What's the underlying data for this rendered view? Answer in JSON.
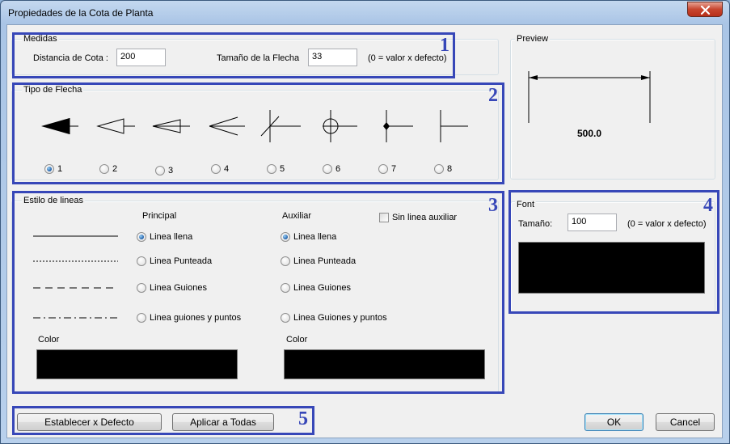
{
  "window": {
    "title": "Propiedades de la Cota de Planta"
  },
  "medidas": {
    "group_label": "Medidas",
    "distancia_label": "Distancia de Cota :",
    "distancia_value": "200",
    "flecha_label": "Tamaño de la Flecha",
    "flecha_value": "33",
    "hint": "(0 = valor x defecto)"
  },
  "tipo_flecha": {
    "group_label": "Tipo de Flecha",
    "options": [
      "1",
      "2",
      "3",
      "4",
      "5",
      "6",
      "7",
      "8"
    ],
    "selected": "1"
  },
  "estilo": {
    "group_label": "Estilo de lineas",
    "principal_header": "Principal",
    "auxiliar_header": "Auxiliar",
    "sin_linea_auxiliar": "Sin linea auxiliar",
    "principal_options": [
      "Linea llena",
      "Linea Punteada",
      "Linea Guiones",
      "Linea guiones y puntos"
    ],
    "auxiliar_options": [
      "Linea llena",
      "Linea Punteada",
      "Linea Guiones",
      "Linea Guiones y puntos"
    ],
    "principal_selected": "Linea llena",
    "auxiliar_selected": "Linea llena",
    "color_label_principal": "Color",
    "color_label_auxiliar": "Color",
    "principal_color": "#000000",
    "auxiliar_color": "#000000"
  },
  "preview": {
    "label": "Preview",
    "dimension_text": "500.0"
  },
  "font": {
    "group_label": "Font",
    "size_label": "Tamaño:",
    "size_value": "100",
    "hint": "(0 = valor x defecto)",
    "color": "#000000"
  },
  "buttons": {
    "defaults": "Establecer x Defecto",
    "apply_all": "Aplicar a Todas",
    "ok": "OK",
    "cancel": "Cancel"
  },
  "annotations": [
    "1",
    "2",
    "3",
    "4",
    "5"
  ],
  "colors": {
    "annotation": "#3747b8",
    "close_button": "#c7452e"
  }
}
